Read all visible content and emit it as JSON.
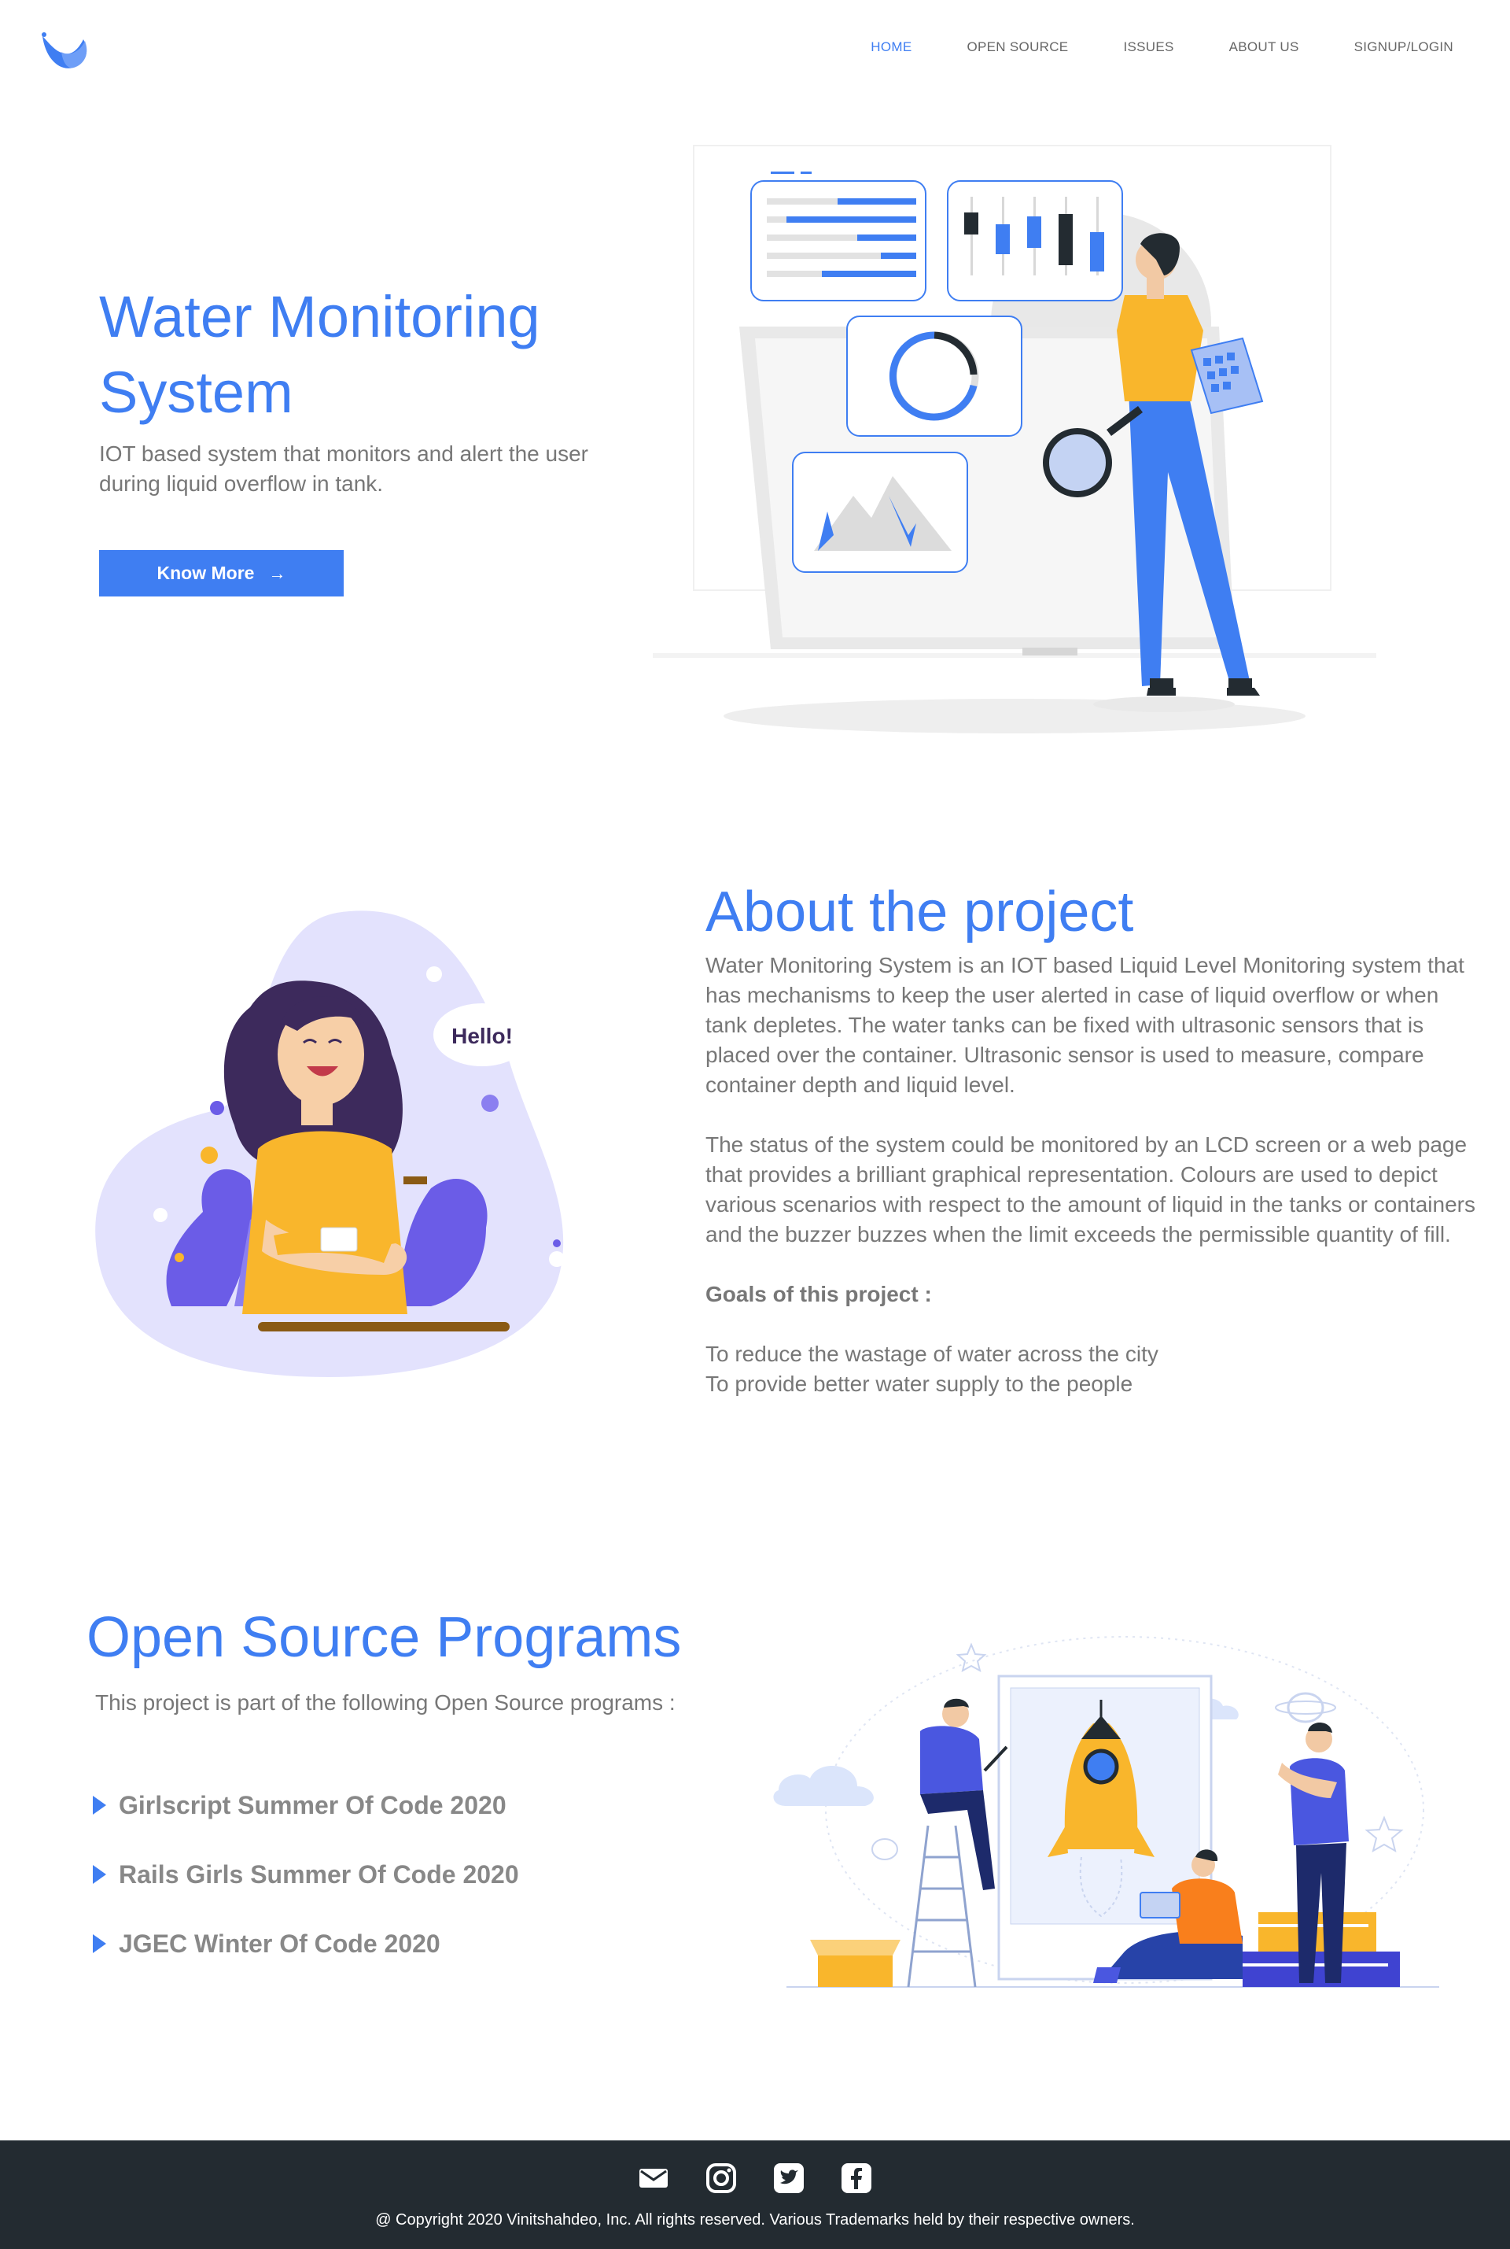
{
  "nav": {
    "items": [
      {
        "label": "HOME",
        "active": true
      },
      {
        "label": "OPEN SOURCE",
        "active": false
      },
      {
        "label": "ISSUES",
        "active": false
      },
      {
        "label": "ABOUT US",
        "active": false
      },
      {
        "label": "SIGNUP/LOGIN",
        "active": false
      }
    ]
  },
  "hero": {
    "title": "Water Monitoring System",
    "subtitle": "IOT based system that monitors and alert the user during liquid overflow in tank.",
    "button_label": "Know More"
  },
  "about": {
    "title": "About the project",
    "paragraph1": "Water Monitoring System is an IOT based Liquid Level Monitoring system that has mechanisms to keep the user alerted in case of liquid overflow or when tank depletes. The water tanks can be fixed with ultrasonic sensors that is placed over the container. Ultrasonic sensor is used to measure, compare container depth and liquid level.",
    "paragraph2": "The status of the system could be monitored by an LCD screen or a web page that provides a brilliant graphical representation. Colours are used to depict various scenarios with respect to the amount of liquid in the tanks or containers and the buzzer buzzes when the limit exceeds the permissible quantity of fill.",
    "goals_title": "Goals of this project :",
    "goals": [
      "To reduce the wastage of water across the city",
      "To provide better water supply to the people"
    ],
    "illustration_text": "Hello!"
  },
  "open_source": {
    "title": "Open Source Programs",
    "subtitle": "This project is part of the following Open Source programs :",
    "programs": [
      "Girlscript Summer Of Code 2020",
      "Rails Girls Summer Of Code 2020",
      "JGEC Winter Of Code 2020"
    ]
  },
  "footer": {
    "icons": [
      "mail-icon",
      "instagram-icon",
      "twitter-icon",
      "facebook-icon"
    ],
    "copyright": "@ Copyright 2020 Vinitshahdeo, Inc. All rights reserved. Various Trademarks held by their respective owners."
  },
  "colors": {
    "accent": "#3f7ef2",
    "text": "#777777",
    "footer_bg": "#232b31",
    "illustration_yellow": "#f9b62c",
    "illustration_purple": "#6b5ce7"
  }
}
